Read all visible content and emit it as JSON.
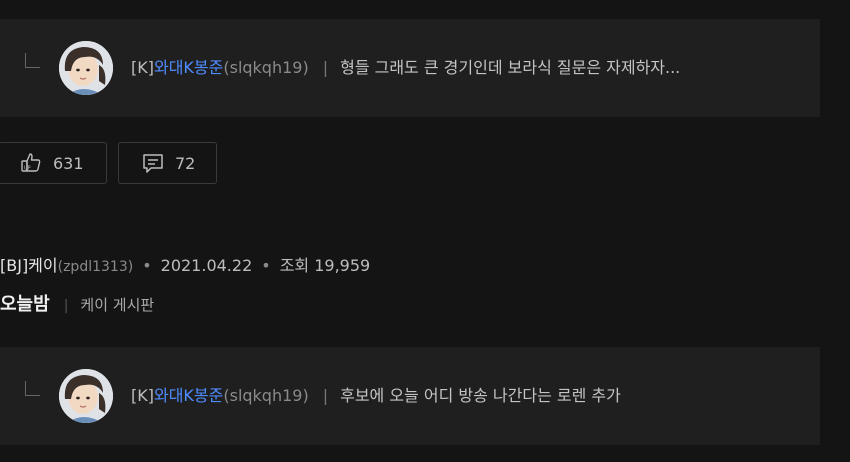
{
  "replies": [
    {
      "tag": "[K]",
      "nickname": "와대K봉준",
      "user_id": "(slqkqh19)",
      "separator": "|",
      "text": "형들 그래도 큰 경기인데 보라식 질문은 자제하자..."
    },
    {
      "tag": "[K]",
      "nickname": "와대K봉준",
      "user_id": "(slqkqh19)",
      "separator": "|",
      "text": "후보에 오늘 어디 방송 나간다는 로렌 추가"
    }
  ],
  "actions": {
    "like_count": "631",
    "comment_count": "72",
    "like_icon": "thumbs-up-icon",
    "comment_icon": "speech-bubble-icon"
  },
  "post": {
    "author": "[BJ]케이",
    "author_id": "(zpdl1313)",
    "bullet": "•",
    "date": "2021.04.22",
    "views": "조회 19,959",
    "title": "오늘밤",
    "separator": "|",
    "board": "케이 게시판"
  },
  "colors": {
    "background": "#141414",
    "panel": "#1f1f1f",
    "nickname": "#4f8cff",
    "text": "#c4c4c4",
    "muted": "#8a8a8a"
  }
}
